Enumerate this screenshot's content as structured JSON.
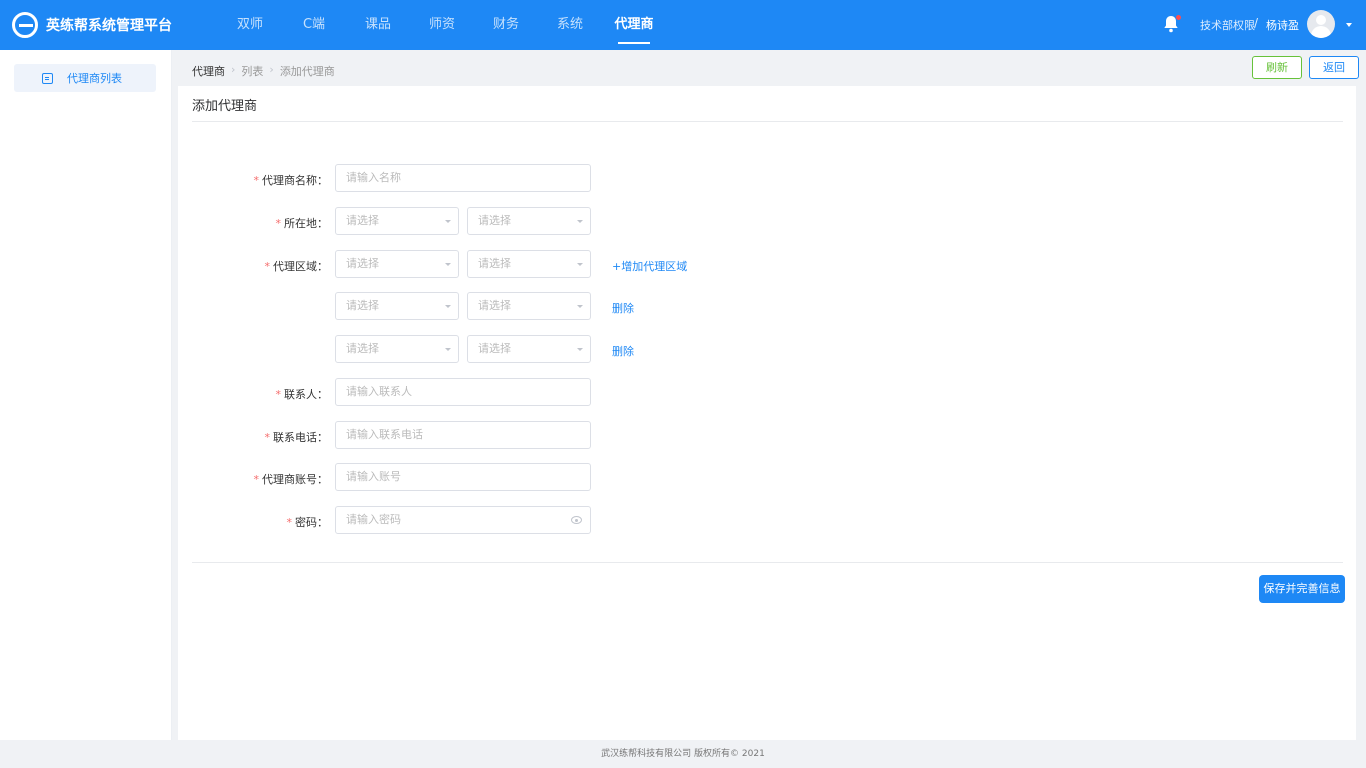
{
  "app": {
    "title": "英练帮系统管理平台"
  },
  "nav": {
    "items": [
      "双师",
      "C端",
      "课品",
      "师资",
      "财务",
      "系统",
      "代理商"
    ],
    "active": "代理商"
  },
  "user": {
    "dept": "技术部权限",
    "separator": "/",
    "name": "杨诗盈"
  },
  "sidebar": {
    "items": [
      {
        "label": "代理商列表"
      }
    ]
  },
  "breadcrumb": {
    "items": [
      "代理商",
      "列表",
      "添加代理商"
    ],
    "separator": "›"
  },
  "toolbar": {
    "refresh_label": "刷新",
    "back_label": "返回"
  },
  "page": {
    "title": "添加代理商"
  },
  "form": {
    "required_mark": "*",
    "name": {
      "label": "代理商名称：",
      "placeholder": "请输入名称",
      "value": ""
    },
    "location": {
      "label": "所在地：",
      "placeholder_left": "请选择",
      "placeholder_right": "请选择"
    },
    "region": {
      "label": "代理区域：",
      "rows": [
        {
          "placeholder_left": "请选择",
          "placeholder_right": "请选择",
          "action": "+增加代理区域"
        },
        {
          "placeholder_left": "请选择",
          "placeholder_right": "请选择",
          "action": "删除"
        },
        {
          "placeholder_left": "请选择",
          "placeholder_right": "请选择",
          "action": "删除"
        }
      ]
    },
    "contact": {
      "label": "联系人：",
      "placeholder": "请输入联系人",
      "value": ""
    },
    "phone": {
      "label": "联系电话：",
      "placeholder": "请输入联系电话",
      "value": ""
    },
    "account": {
      "label": "代理商账号：",
      "placeholder": "请输入账号",
      "value": ""
    },
    "password": {
      "label": "密码：",
      "placeholder": "请输入密码",
      "value": ""
    }
  },
  "actions": {
    "save_label": "保存并完善信息"
  },
  "footer": {
    "text": "武汉练帮科技有限公司 版权所有© 2021"
  },
  "colors": {
    "primary": "#1e88f5",
    "success": "#67c23a",
    "required": "#f56c6c",
    "notification_dot": "#ff4d4f"
  },
  "icons": {
    "logo": "logo-icon",
    "bell": "bell-icon",
    "avatar": "avatar-icon",
    "dropdown": "chevron-down-icon",
    "sidebar": "document-icon",
    "password_toggle": "eye-icon"
  }
}
